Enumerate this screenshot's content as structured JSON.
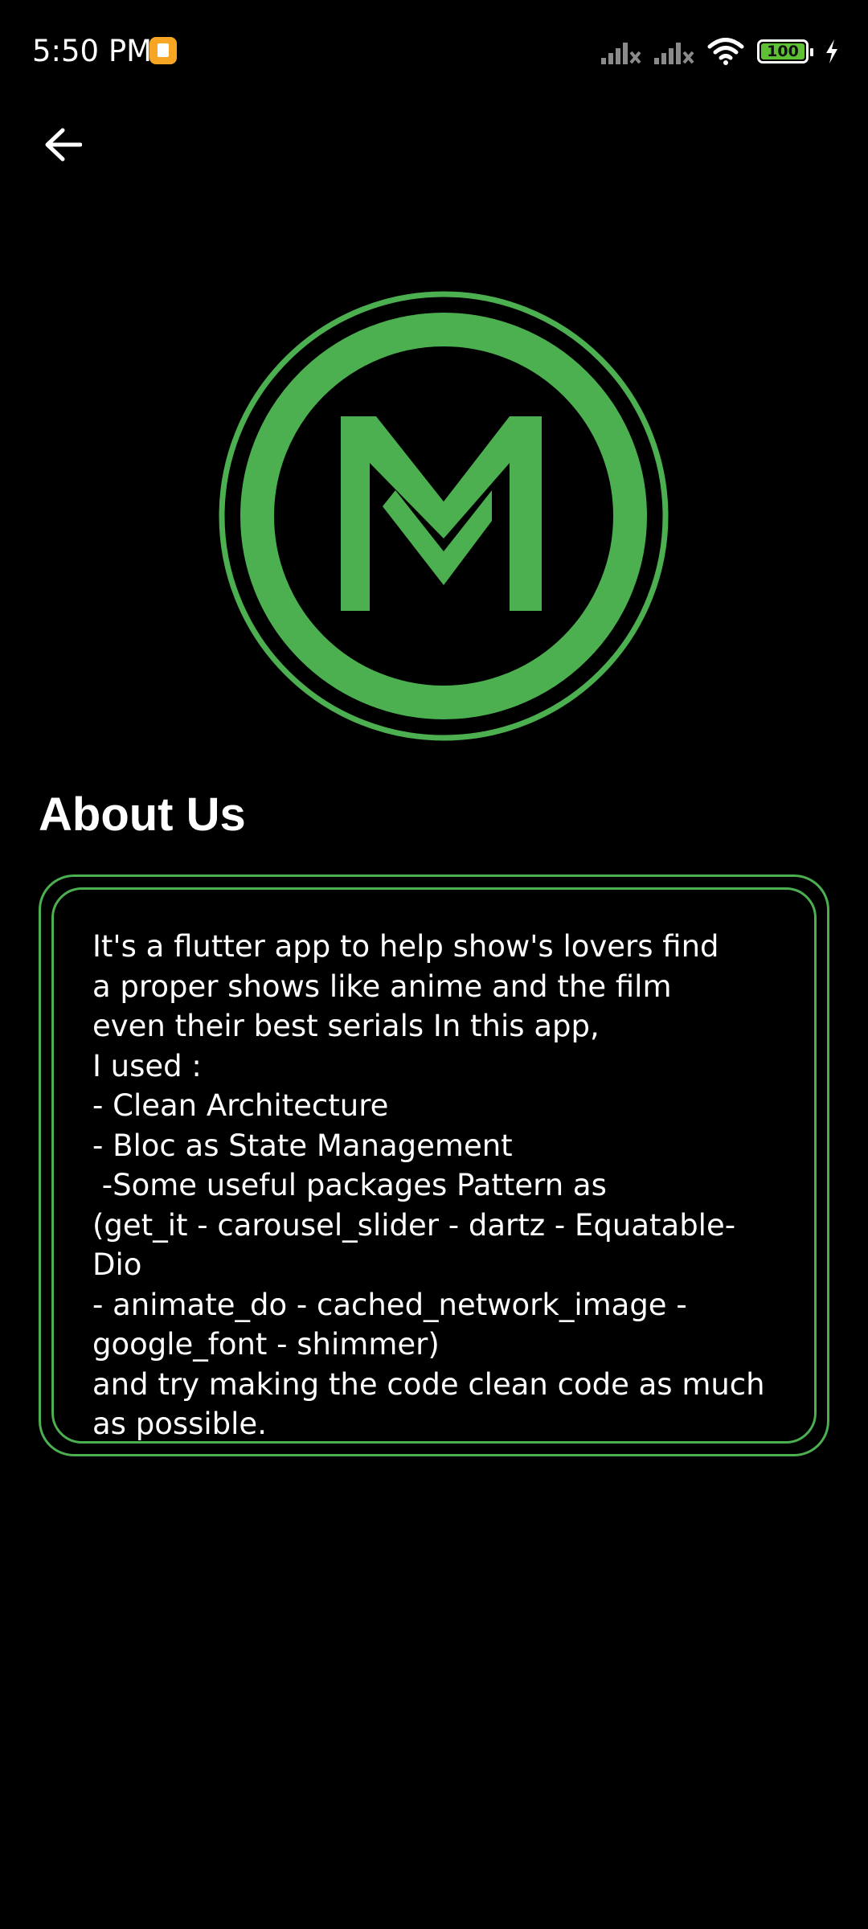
{
  "status_bar": {
    "time": "5:50 PM",
    "battery_level": "100",
    "notification_icon": "app-notification-icon",
    "icons": [
      "signal-x-icon",
      "signal-x-icon",
      "wifi-icon",
      "battery-icon",
      "charging-bolt-icon"
    ]
  },
  "app_bar": {
    "back_icon": "arrow-left-icon"
  },
  "logo": {
    "icon": "m-logo-icon",
    "accent_color": "#4caf50"
  },
  "about": {
    "title": "About Us",
    "body": "It's a flutter app to help show's lovers find\na proper shows like anime and the film\neven their best serials In this app,\nI used :\n- Clean Architecture\n- Bloc as State Management\n -Some useful packages Pattern as\n(get_it - carousel_slider - dartz - Equatable- Dio\n- animate_do - cached_network_image -\ngoogle_font - shimmer)\nand try making the code clean code as much\nas possible.",
    "border_color": "#4caf50"
  },
  "colors": {
    "background": "#000000",
    "text": "#ffffff",
    "accent": "#4caf50"
  }
}
